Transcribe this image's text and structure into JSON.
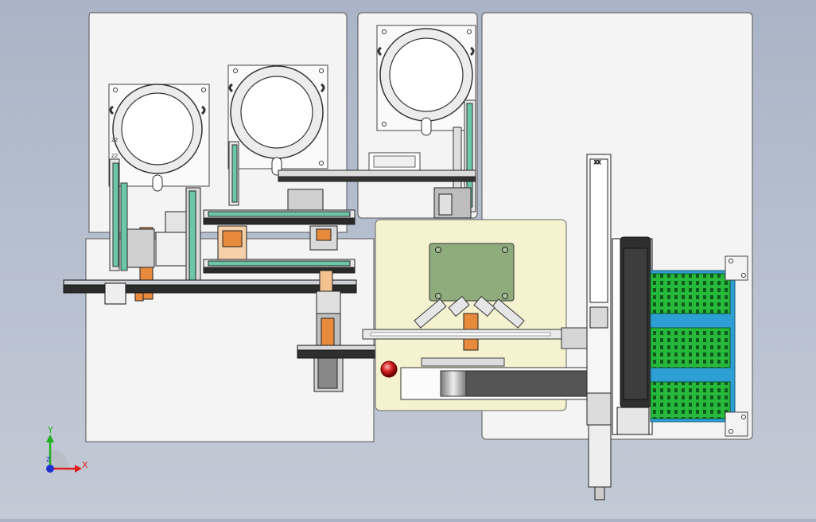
{
  "title": "",
  "triad": {
    "y_label": "Y",
    "x_label": "X",
    "z_label": "Z",
    "x_color": "#e02020",
    "y_color": "#20b020",
    "z_color": "#2030d0"
  },
  "labels": {
    "stack_marker_1": "ZZ",
    "stack_marker_2": "ZZ",
    "column_cap": "XX"
  },
  "colors": {
    "background": "#b3bccb",
    "plate": "#f4f4f4",
    "work_area": "#f5f2cf",
    "rail_green": "#6cc7a6",
    "plate_green": "#8fac7c",
    "orange_block": "#e88a3c",
    "rack_blue": "#2d9fd4",
    "rack_green": "#28b83c",
    "motor_dark": "#2e2e2e"
  }
}
